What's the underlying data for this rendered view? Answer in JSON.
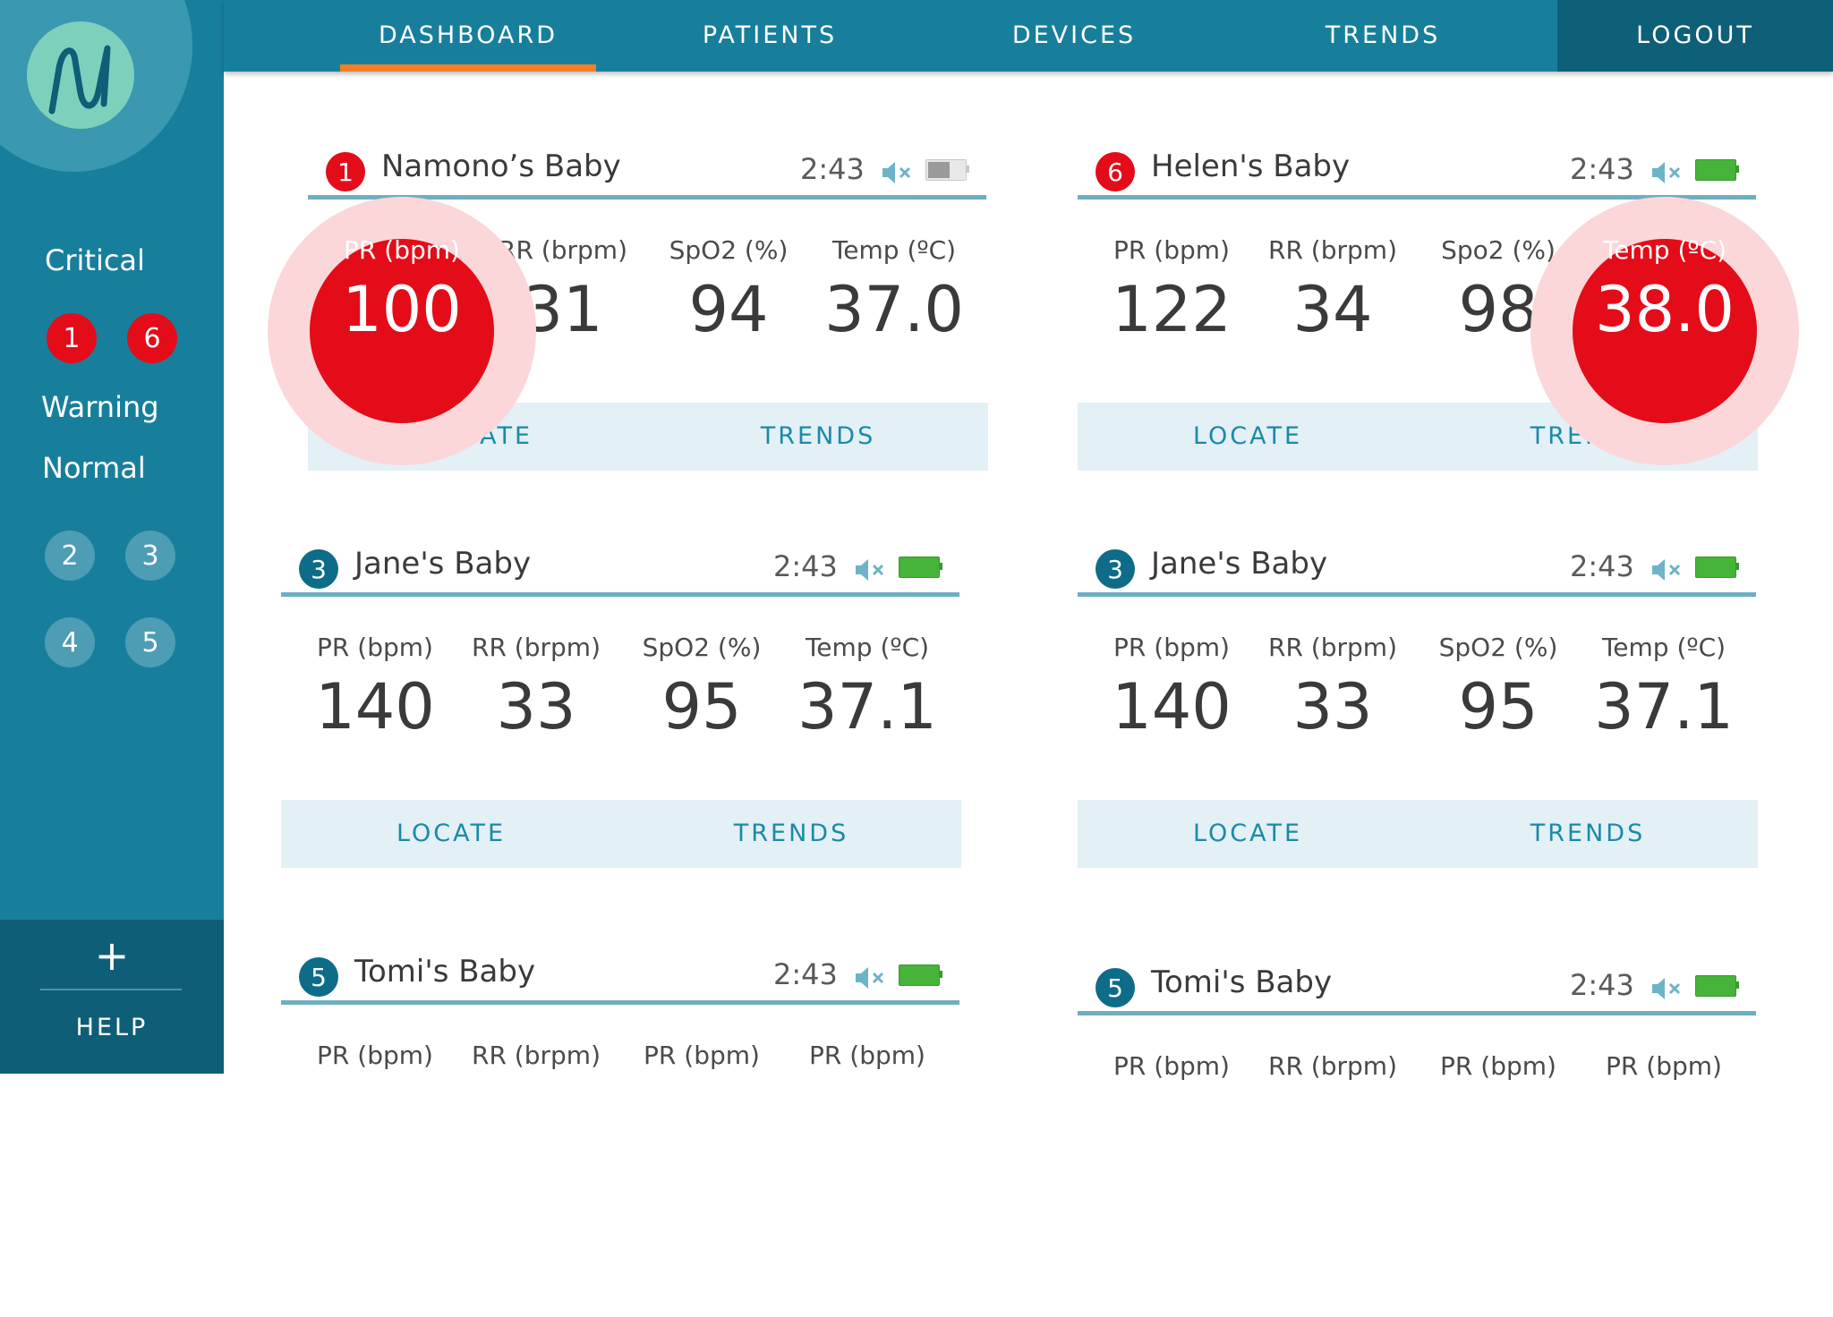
{
  "nav": {
    "tabs": [
      "DASHBOARD",
      "PATIENTS",
      "DEVICES",
      "TRENDS"
    ],
    "logout": "LOGOUT",
    "active_tab": "DASHBOARD"
  },
  "sidebar": {
    "critical_label": "Critical",
    "critical_ids": [
      "1",
      "6"
    ],
    "warning_label": "Warning",
    "normal_label": "Normal",
    "normal_ids": [
      "2",
      "3",
      "4",
      "5"
    ],
    "add_symbol": "+",
    "help_label": "HELP"
  },
  "colors": {
    "primary": "#177f9c",
    "dark": "#0f5e78",
    "critical": "#e40c19",
    "accent": "#f07f25",
    "battery_full": "#46b339"
  },
  "cards": [
    {
      "id": "1",
      "status": "critical",
      "name": "Namono’s Baby",
      "time": "2:43",
      "battery": "low",
      "vitals": [
        {
          "label": "PR (bpm)",
          "value": "100",
          "alert": true
        },
        {
          "label": "RR (brpm)",
          "value": "31"
        },
        {
          "label": "SpO2 (%)",
          "value": "94"
        },
        {
          "label": "Temp (ºC)",
          "value": "37.0"
        }
      ],
      "locate": "LOCATE",
      "trends": "TRENDS"
    },
    {
      "id": "6",
      "status": "critical",
      "name": "Helen's Baby",
      "time": "2:43",
      "battery": "full",
      "vitals": [
        {
          "label": "PR (bpm)",
          "value": "122"
        },
        {
          "label": "RR (brpm)",
          "value": "34"
        },
        {
          "label": "Spo2 (%)",
          "value": "98"
        },
        {
          "label": "Temp (ºC)",
          "value": "38.0",
          "alert": true
        }
      ],
      "locate": "LOCATE",
      "trends": "TRENDS"
    },
    {
      "id": "3",
      "status": "normal",
      "name": "Jane's Baby",
      "time": "2:43",
      "battery": "full",
      "vitals": [
        {
          "label": "PR (bpm)",
          "value": "140"
        },
        {
          "label": "RR (brpm)",
          "value": "33"
        },
        {
          "label": "SpO2 (%)",
          "value": "95"
        },
        {
          "label": "Temp (ºC)",
          "value": "37.1"
        }
      ],
      "locate": "LOCATE",
      "trends": "TRENDS"
    },
    {
      "id": "3",
      "status": "normal",
      "name": "Jane's Baby",
      "time": "2:43",
      "battery": "full",
      "vitals": [
        {
          "label": "PR (bpm)",
          "value": "140"
        },
        {
          "label": "RR (brpm)",
          "value": "33"
        },
        {
          "label": "SpO2 (%)",
          "value": "95"
        },
        {
          "label": "Temp (ºC)",
          "value": "37.1"
        }
      ],
      "locate": "LOCATE",
      "trends": "TRENDS"
    },
    {
      "id": "5",
      "status": "normal",
      "name": "Tomi's Baby",
      "time": "2:43",
      "battery": "full",
      "vitals": [
        {
          "label": "PR (bpm)",
          "value": ""
        },
        {
          "label": "RR (brpm)",
          "value": ""
        },
        {
          "label": "PR (bpm)",
          "value": ""
        },
        {
          "label": "PR (bpm)",
          "value": ""
        }
      ],
      "locate": "",
      "trends": ""
    },
    {
      "id": "5",
      "status": "normal",
      "name": "Tomi's Baby",
      "time": "2:43",
      "battery": "full",
      "vitals": [
        {
          "label": "PR (bpm)",
          "value": ""
        },
        {
          "label": "RR (brpm)",
          "value": ""
        },
        {
          "label": "PR (bpm)",
          "value": ""
        },
        {
          "label": "PR (bpm)",
          "value": ""
        }
      ],
      "locate": "",
      "trends": ""
    }
  ]
}
